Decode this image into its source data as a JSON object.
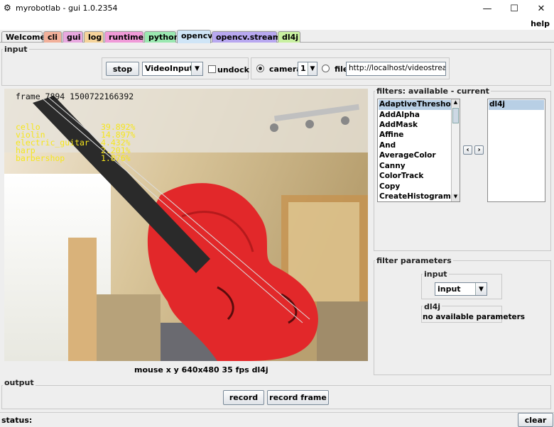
{
  "window": {
    "title": "myrobotlab - gui 1.0.2354",
    "minimize_glyph": "—",
    "maximize_glyph": "☐",
    "close_glyph": "✕"
  },
  "menu": {
    "help_label": "help"
  },
  "tabs": [
    {
      "label": "Welcome",
      "color": "#eeeeee"
    },
    {
      "label": "cli",
      "color": "#f2b09a"
    },
    {
      "label": "gui",
      "color": "#e8a8e0"
    },
    {
      "label": "log",
      "color": "#f5d39a"
    },
    {
      "label": "runtime",
      "color": "#f09ad8"
    },
    {
      "label": "python",
      "color": "#9ae8b0"
    },
    {
      "label": "opencv",
      "color": "#cfe5f7"
    },
    {
      "label": "opencv.streamer",
      "color": "#b8a8f0"
    },
    {
      "label": "dl4j",
      "color": "#c8f0a0"
    }
  ],
  "input_panel": {
    "title": "input",
    "stop_label": "stop",
    "grabber_value": "VideoInput",
    "undock_label": "undock",
    "camera_label": "camera",
    "camera_index": "1",
    "file_label": "file",
    "file_url": "http://localhost/videostream.cgi"
  },
  "video": {
    "frame_text": "frame 7894 1500722166392",
    "classifications": [
      {
        "name": "cello",
        "value": "39.892%"
      },
      {
        "name": "violin",
        "value": "14.897%"
      },
      {
        "name": "electric_guitar",
        "value": "4.432%"
      },
      {
        "name": "harp",
        "value": "2.201%"
      },
      {
        "name": "barbershop",
        "value": "1.876%"
      }
    ],
    "status_text": "mouse x y  640x480  35 fps  dl4j"
  },
  "filters": {
    "title": "filters: available - current",
    "available": [
      "AdaptiveThreshold",
      "AddAlpha",
      "AddMask",
      "Affine",
      "And",
      "AverageColor",
      "Canny",
      "ColorTrack",
      "Copy",
      "CreateHistogram"
    ],
    "current": [
      "dl4j"
    ],
    "left_arrow": "‹",
    "right_arrow": "›"
  },
  "filter_params": {
    "title": "filter parameters",
    "input_title": "input",
    "input_value": "input",
    "dl4j_title": "dl4j",
    "dl4j_text": "no available parameters"
  },
  "output_panel": {
    "title": "output",
    "record_label": "record",
    "record_frame_label": "record frame"
  },
  "statusbar": {
    "label": "status:",
    "clear_label": "clear"
  },
  "icons": {
    "app": "robot-icon",
    "dropdown_arrow": "▼",
    "scroll_up": "▲",
    "scroll_down": "▼"
  }
}
